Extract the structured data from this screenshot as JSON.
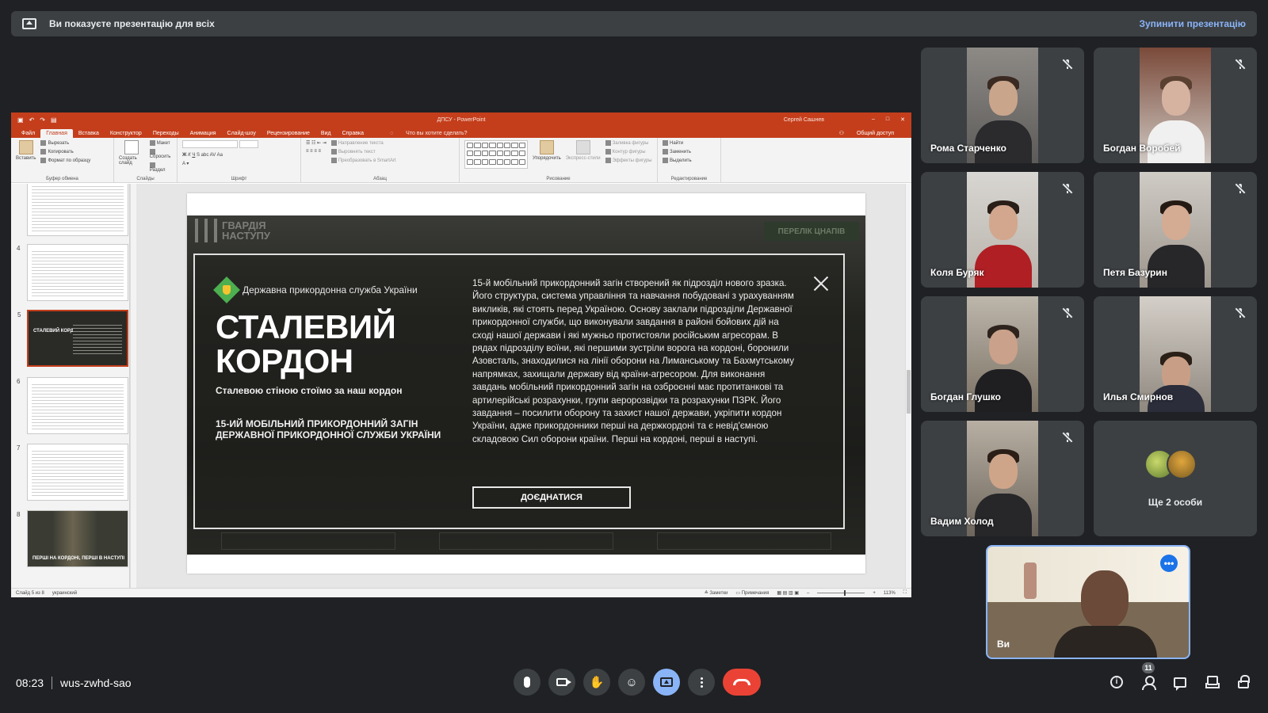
{
  "banner": {
    "text": "Ви показуєте презентацію для всіх",
    "stop_label": "Зупинити презентацію"
  },
  "ppt": {
    "doc_title": "ДПСУ - PowerPoint",
    "user": "Сергей Сашнев",
    "tabs": [
      "Файл",
      "Главная",
      "Вставка",
      "Конструктор",
      "Переходы",
      "Анимация",
      "Слайд-шоу",
      "Рецензирование",
      "Вид",
      "Справка"
    ],
    "tell_me": "Что вы хотите сделать?",
    "share": "Общий доступ",
    "ribbon": {
      "paste": "Вставить",
      "cut": "Вырезать",
      "copy": "Копировать",
      "format_painter": "Формат по образцу",
      "clipboard_group": "Буфер обмена",
      "new_slide": "Создать слайд",
      "layout": "Макет",
      "reset": "Сбросить",
      "section": "Раздел",
      "slides_group": "Слайды",
      "font_group": "Шрифт",
      "text_direction": "Направление текста",
      "align_text": "Выровнять текст",
      "smartart": "Преобразовать в SmartArt",
      "paragraph_group": "Абзац",
      "arrange": "Упорядочить",
      "quick_styles": "Экспресс-стили",
      "shape_fill": "Заливка фигуры",
      "shape_outline": "Контур фигуры",
      "shape_effects": "Эффекты фигуры",
      "drawing_group": "Рисование",
      "find": "Найти",
      "replace": "Заменить",
      "select": "Выделить",
      "editing_group": "Редактирование"
    },
    "thumbs": [
      {
        "num": "",
        "kind": "text"
      },
      {
        "num": "4",
        "kind": "text"
      },
      {
        "num": "5",
        "kind": "selected",
        "mini": "СТАЛЕВИЙ КОРДОН"
      },
      {
        "num": "6",
        "kind": "text"
      },
      {
        "num": "7",
        "kind": "text"
      },
      {
        "num": "8",
        "kind": "soldier",
        "mini": "ПЕРШІ НА КОРДОНІ, ПЕРШІ В НАСТУПІ"
      }
    ],
    "status": {
      "slide": "Слайд 5 из 8",
      "language": "украинский",
      "notes": "Заметки",
      "comments": "Примечания",
      "zoom": "113%"
    }
  },
  "slide": {
    "brand": "ГВАРДІЯ НАСТУПУ",
    "top_button": "ПЕРЕЛІК ЦНАПІВ",
    "org": "Державна прикордонна служба України",
    "title_line1": "СТАЛЕВИЙ",
    "title_line2": "КОРДОН",
    "slogan": "Сталевою стіною стоїмо за наш кордон",
    "unit": "15-ИЙ МОБІЛЬНИЙ ПРИКОРДОННИЙ ЗАГІН ДЕРЖАВНОЇ ПРИКОРДОННОЇ СЛУЖБИ УКРАЇНИ",
    "description": "15-й мобільний прикордонний загін створений як підрозділ нового зразка. Його структура, система управління та навчання побудовані з урахуванням викликів, які стоять перед Україною. Основу заклали підрозділи Державної прикордонної служби, що виконували завдання в районі бойових дій на сході нашої держави і які мужньо протистояли російським агресорам. В рядах підрозділу воїни, які першими зустріли ворога на кордоні, боронили Азовсталь, знаходилися на лінії оборони на Лиманському та Бахмутському напрямках, захищали державу від країни-агресором. Для виконання завдань мобільний прикордонний загін на озброєнні має протитанкові та артилерійські розрахунки, групи аеророзвідки та розрахунки ПЗРК. Його завдання – посилити оборону та захист нашої держави, укріпити кордон України, адже прикордонники перші на держкордоні та є невід'ємною складовою Сил оборони країни. Перші на кордоні, перші в наступі.",
    "join_label": "ДОЄДНАТИСЯ"
  },
  "participants": [
    {
      "name": "Рома Старченко",
      "muted": true
    },
    {
      "name": "Богдан Воробей",
      "muted": true
    },
    {
      "name": "Коля Буряк",
      "muted": true
    },
    {
      "name": "Петя Базурин",
      "muted": true
    },
    {
      "name": "Богдан Глушко",
      "muted": true
    },
    {
      "name": "Илья Смирнов",
      "muted": true
    },
    {
      "name": "Вадим Холод",
      "muted": true
    }
  ],
  "more_participants": "Ще 2 особи",
  "self": {
    "name": "Ви"
  },
  "meeting": {
    "time": "08:23",
    "code": "wus-zwhd-sao",
    "participant_count": "11"
  },
  "colors": {
    "background": "#202124",
    "tile": "#3c4043",
    "accent": "#8ab4f8",
    "end_call": "#ea4335",
    "ppt_brand": "#c43e1c"
  }
}
